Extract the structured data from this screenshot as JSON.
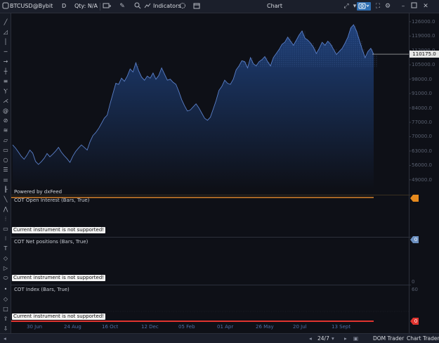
{
  "toolbar": {
    "symbol": "BTCUSD@Bybit",
    "timeframe": "D",
    "qty": "Qty: N/A",
    "indicators": "Indicators",
    "window_title": "Chart"
  },
  "chart_data": {
    "type": "area",
    "title": "",
    "xlabel": "",
    "ylabel": "",
    "ylim": [
      45000,
      130000
    ],
    "y_ticks": [
      "126000.0",
      "119000.0",
      "112000.0",
      "105000.0",
      "98000.0",
      "91000.0",
      "84000.0",
      "77000.0",
      "70000.0",
      "63000.0",
      "56000.0",
      "49000.0"
    ],
    "x_ticks": [
      "30 Jun",
      "24 Aug",
      "16 Oct",
      "12 Dec",
      "05 Feb",
      "01 Apr",
      "26 May",
      "20 Jul",
      "13 Sept"
    ],
    "last_price": "110175.0",
    "series": [
      {
        "values": [
          66000,
          64500,
          62500,
          60500,
          59000,
          61000,
          63500,
          62000,
          58000,
          56500,
          57800,
          59500,
          61800,
          60200,
          61500,
          63000,
          64800,
          62500,
          60800,
          59300,
          57500,
          60500,
          62800,
          64500,
          66000,
          64800,
          63500,
          67500,
          70500,
          72000,
          74000,
          76500,
          79000,
          80500,
          86000,
          91000,
          96000,
          95500,
          98500,
          97000,
          99500,
          103000,
          101500,
          106000,
          102000,
          99000,
          97500,
          99500,
          98500,
          101000,
          98000,
          99800,
          103500,
          100500,
          97500,
          98000,
          96500,
          95500,
          92000,
          88000,
          85000,
          82500,
          83000,
          84500,
          86000,
          84000,
          81500,
          79000,
          78000,
          79500,
          83500,
          87500,
          92500,
          94500,
          97500,
          96000,
          95500,
          98000,
          102500,
          104500,
          107000,
          106500,
          103500,
          108500,
          105500,
          104500,
          106500,
          107500,
          109000,
          106500,
          104500,
          108500,
          110500,
          112500,
          115000,
          116000,
          118500,
          116500,
          114500,
          117000,
          119500,
          121500,
          118000,
          117000,
          115500,
          113500,
          110500,
          113000,
          116000,
          114500,
          116500,
          115000,
          112500,
          110000,
          111500,
          113000,
          115500,
          118500,
          123000,
          124500,
          121500,
          117000,
          112500,
          108500,
          111500,
          113000,
          110175
        ]
      }
    ]
  },
  "price_axis_main": {
    "last_price": "110175.0"
  },
  "panes": {
    "powered_by": "Powered by dxFeed",
    "oi": {
      "title": "COT Open Interest (Bars, True)",
      "message": "Current instrument is not supported!"
    },
    "net": {
      "title": "COT Net positions (Bars, True)",
      "message": "Current instrument is not supported!",
      "axis_badge": "0",
      "axis_zero": "0"
    },
    "idx": {
      "title": "COT Index (Bars, True)",
      "message": "Current instrument is not supported!",
      "axis_top": "60",
      "axis_badge": "0"
    }
  },
  "bottombar": {
    "session": "24/7",
    "dom_trader": "DOM Trader",
    "chart_trader": "Chart Trader"
  },
  "colors": {
    "line": "#5a7fc8",
    "fill_top": "#1e3f78",
    "fill_bottom": "#0e1017",
    "oi_line": "#d9822b",
    "idx_line": "#e0342f",
    "accent": "#3b82c4"
  }
}
